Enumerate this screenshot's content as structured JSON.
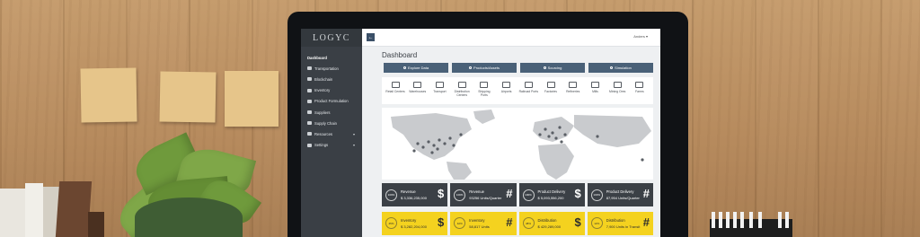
{
  "app": {
    "logo": "LOGYC",
    "user": "Anders ▾",
    "page_title": "Dashboard"
  },
  "sidebar": {
    "items": [
      {
        "label": "Dashboard",
        "icon": "dashboard",
        "active": true
      },
      {
        "label": "Transportation",
        "icon": "truck-icon"
      },
      {
        "label": "Blockchain",
        "icon": "link-icon"
      },
      {
        "label": "Inventory",
        "icon": "boxes-icon"
      },
      {
        "label": "Product Formulation",
        "icon": "document-icon"
      },
      {
        "label": "Suppliers",
        "icon": "users-icon"
      },
      {
        "label": "Supply Chain",
        "icon": "network-icon"
      },
      {
        "label": "Resources",
        "icon": "grid-icon",
        "caret": "▾"
      },
      {
        "label": "Settings",
        "icon": "gear-icon",
        "caret": "▾"
      }
    ]
  },
  "actions": [
    {
      "label": "Explore Data"
    },
    {
      "label": "Products/Assets"
    },
    {
      "label": "Sourcing"
    },
    {
      "label": "Simulation"
    }
  ],
  "categories": [
    {
      "label": "Retail Centers"
    },
    {
      "label": "Warehouses"
    },
    {
      "label": "Transport"
    },
    {
      "label": "Distribution Centers"
    },
    {
      "label": "Shipping Ports"
    },
    {
      "label": "Airports"
    },
    {
      "label": "Railroad Ports"
    },
    {
      "label": "Factories"
    },
    {
      "label": "Refineries"
    },
    {
      "label": "Mills"
    },
    {
      "label": "Mining Ores"
    },
    {
      "label": "Farms"
    }
  ],
  "cards": [
    {
      "title": "Revenue",
      "value": "$ 3,336,235,000",
      "ring": "100%",
      "symbol": "$",
      "style": "dark"
    },
    {
      "title": "Revenue",
      "value": "93256 Units/Quarter",
      "ring": "100%",
      "symbol": "#",
      "style": "dark"
    },
    {
      "title": "Product Delivery",
      "value": "$ 5,093,556,200",
      "ring": "100%",
      "symbol": "$",
      "style": "dark"
    },
    {
      "title": "Product Delivery",
      "value": "87,954 Units/Quarter",
      "ring": "100%",
      "symbol": "#",
      "style": "dark"
    },
    {
      "title": "Inventory",
      "value": "$ 3,282,204,000",
      "ring": "45%",
      "symbol": "$",
      "style": "yellow"
    },
    {
      "title": "Inventory",
      "value": "58,817 Units",
      "ring": "42%",
      "symbol": "#",
      "style": "yellow"
    },
    {
      "title": "Distribution",
      "value": "$ 429,289,000",
      "ring": "48%",
      "symbol": "$",
      "style": "yellow"
    },
    {
      "title": "Distribution",
      "value": "7,900 Units in Transit",
      "ring": "12%",
      "symbol": "#",
      "style": "yellow"
    }
  ],
  "colors": {
    "sidebar": "#3a3f45",
    "action": "#4a6178",
    "card_dark": "#3b4046",
    "card_yellow": "#f4d21f"
  }
}
